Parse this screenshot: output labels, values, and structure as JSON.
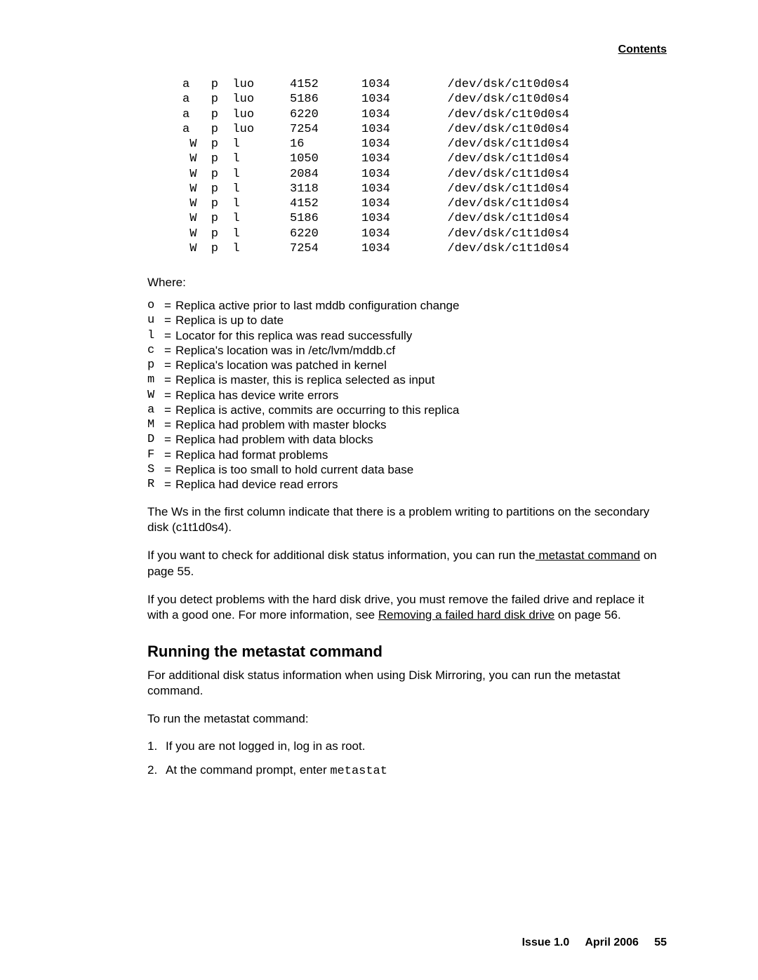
{
  "header": {
    "contents_link": "Contents"
  },
  "table_rows": [
    {
      "c1": "a",
      "c2": "p",
      "c3": "luo",
      "c4": "4152",
      "c5": "1034",
      "c6": "/dev/dsk/c1t0d0s4"
    },
    {
      "c1": "a",
      "c2": "p",
      "c3": "luo",
      "c4": "5186",
      "c5": "1034",
      "c6": "/dev/dsk/c1t0d0s4"
    },
    {
      "c1": "a",
      "c2": "p",
      "c3": "luo",
      "c4": "6220",
      "c5": "1034",
      "c6": "/dev/dsk/c1t0d0s4"
    },
    {
      "c1": "a",
      "c2": "p",
      "c3": "luo",
      "c4": "7254",
      "c5": "1034",
      "c6": "/dev/dsk/c1t0d0s4"
    },
    {
      "c1": " W",
      "c2": "p",
      "c3": "l",
      "c4": "16",
      "c5": "1034",
      "c6": "/dev/dsk/c1t1d0s4"
    },
    {
      "c1": " W",
      "c2": "p",
      "c3": "l",
      "c4": "1050",
      "c5": "1034",
      "c6": "/dev/dsk/c1t1d0s4"
    },
    {
      "c1": " W",
      "c2": "p",
      "c3": "l",
      "c4": "2084",
      "c5": "1034",
      "c6": "/dev/dsk/c1t1d0s4"
    },
    {
      "c1": " W",
      "c2": "p",
      "c3": "l",
      "c4": "3118",
      "c5": "1034",
      "c6": "/dev/dsk/c1t1d0s4"
    },
    {
      "c1": " W",
      "c2": "p",
      "c3": "l",
      "c4": "4152",
      "c5": "1034",
      "c6": "/dev/dsk/c1t1d0s4"
    },
    {
      "c1": " W",
      "c2": "p",
      "c3": "l",
      "c4": "5186",
      "c5": "1034",
      "c6": "/dev/dsk/c1t1d0s4"
    },
    {
      "c1": " W",
      "c2": "p",
      "c3": "l",
      "c4": "6220",
      "c5": "1034",
      "c6": "/dev/dsk/c1t1d0s4"
    },
    {
      "c1": " W",
      "c2": "p",
      "c3": "l",
      "c4": "7254",
      "c5": "1034",
      "c6": "/dev/dsk/c1t1d0s4"
    }
  ],
  "where_heading": "Where:",
  "legend": [
    {
      "code": "o",
      "desc": "Replica active prior to last mddb configuration change"
    },
    {
      "code": "u",
      "desc": "Replica is up to date"
    },
    {
      "code": "l",
      "desc": "Locator for this replica was read successfully"
    },
    {
      "code": "c",
      "desc": "Replica's location was in /etc/lvm/mddb.cf"
    },
    {
      "code": "p",
      "desc": "Replica's location was patched in kernel"
    },
    {
      "code": "m",
      "desc": "Replica is master, this is replica selected as input"
    },
    {
      "code": "W",
      "desc": "Replica has device write errors"
    },
    {
      "code": "a",
      "desc": "Replica is active, commits are occurring to this replica"
    },
    {
      "code": "M",
      "desc": "Replica had problem with master blocks"
    },
    {
      "code": "D",
      "desc": "Replica had problem with data blocks"
    },
    {
      "code": "F",
      "desc": "Replica had format problems"
    },
    {
      "code": "S",
      "desc": "Replica is too small to hold current data base"
    },
    {
      "code": "R",
      "desc": "Replica had device read errors"
    }
  ],
  "para1": "The Ws in the first column indicate that there is a problem writing to partitions on the secondary disk (c1t1d0s4).",
  "para2a": "If you want to check for additional disk status information, you can run the",
  "para2_link": " metastat command",
  "para2b": " on page 55.",
  "para3a": "If you detect problems with the hard disk drive, you must remove the failed drive and replace it with a good one. For more information, see ",
  "para3_link": "Removing a failed hard disk drive",
  "para3b": " on page 56.",
  "section_heading": "Running the metastat command",
  "section_intro": "For additional disk status information when using Disk Mirroring, you can run the metastat command.",
  "steps_intro": "To run the metastat command:",
  "steps": [
    {
      "num": "1.",
      "text": "If you are not logged in, log in as root."
    },
    {
      "num": "2.",
      "text_a": "At the command prompt, enter ",
      "code": "metastat"
    }
  ],
  "footer": {
    "issue": "Issue 1.0",
    "date": "April 2006",
    "page": "55"
  }
}
